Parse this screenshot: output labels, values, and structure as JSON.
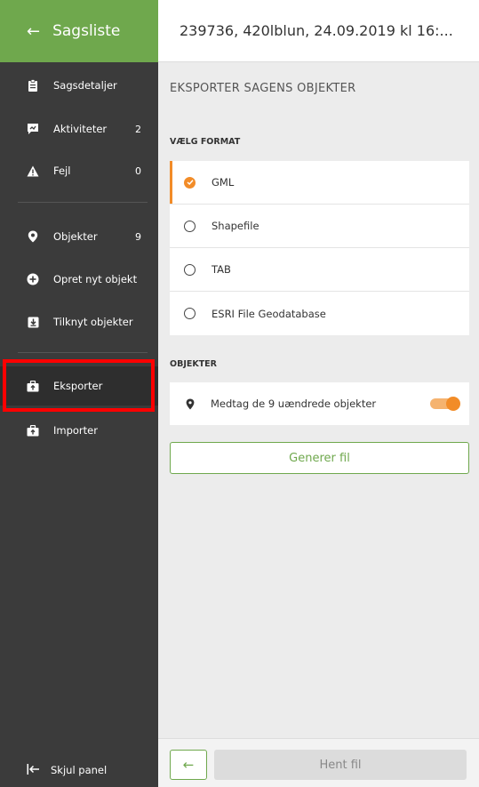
{
  "sidebar": {
    "back_label": "Sagsliste",
    "items": [
      {
        "label": "Sagsdetaljer",
        "icon": "clipboard-icon",
        "count": ""
      },
      {
        "label": "Aktiviteter",
        "icon": "activity-icon",
        "count": "2"
      },
      {
        "label": "Fejl",
        "icon": "warning-icon",
        "count": "0"
      },
      {
        "label": "Objekter",
        "icon": "map-pin-icon",
        "count": "9"
      },
      {
        "label": "Opret nyt objekt",
        "icon": "plus-circle-icon",
        "count": ""
      },
      {
        "label": "Tilknyt objekter",
        "icon": "download-box-icon",
        "count": ""
      },
      {
        "label": "Eksporter",
        "icon": "export-icon",
        "count": ""
      },
      {
        "label": "Importer",
        "icon": "import-icon",
        "count": ""
      }
    ],
    "hide_panel_label": "Skjul panel"
  },
  "header": {
    "title": "239736, 420lblun, 24.09.2019 kl 16:..."
  },
  "main": {
    "section_title": "EKSPORTER SAGENS OBJEKTER",
    "format_label": "VÆLG FORMAT",
    "formats": [
      {
        "label": "GML",
        "selected": true
      },
      {
        "label": "Shapefile",
        "selected": false
      },
      {
        "label": "TAB",
        "selected": false
      },
      {
        "label": "ESRI File Geodatabase",
        "selected": false
      }
    ],
    "objects_label": "OBJEKTER",
    "objects_toggle_label": "Medtag de 9 uændrede objekter",
    "objects_toggle_on": true,
    "generate_label": "Generer fil"
  },
  "footer": {
    "back_icon": "arrow-left-icon",
    "fetch_label": "Hent fil"
  },
  "colors": {
    "accent_green": "#6fa84d",
    "accent_orange": "#f28c28",
    "sidebar_bg": "#3b3b3b",
    "highlight_red": "#ff0000"
  }
}
